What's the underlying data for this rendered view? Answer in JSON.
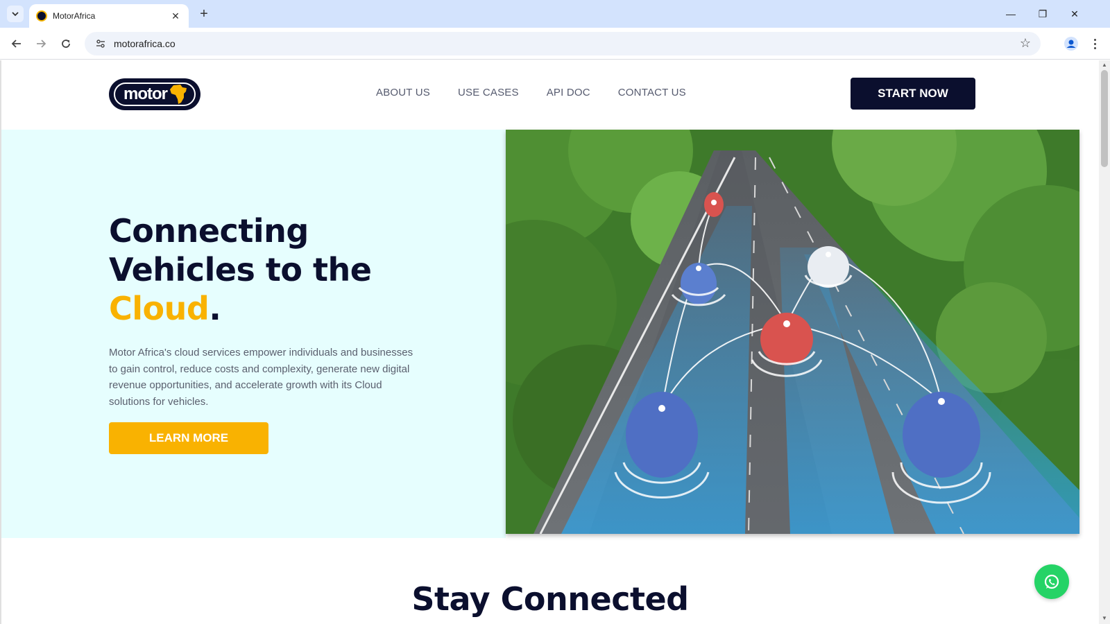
{
  "browser": {
    "tab_title": "MotorAfrica",
    "url": "motorafrica.co",
    "new_tab": "+",
    "close_tab": "✕",
    "win_minimize": "—",
    "win_restore": "❐",
    "win_close": "✕"
  },
  "header": {
    "logo_text": "motor",
    "nav": [
      "ABOUT US",
      "USE CASES",
      "API DOC",
      "CONTACT US"
    ],
    "cta": "START NOW"
  },
  "hero": {
    "title_line1": "Connecting",
    "title_line2": "Vehicles to the",
    "title_accent": "Cloud",
    "title_end": ".",
    "description": "Motor Africa's cloud services empower individuals and businesses to gain control, reduce costs and complexity, generate new digital revenue opportunities, and accelerate growth with its Cloud solutions for vehicles.",
    "button": "LEARN MORE"
  },
  "section": {
    "title": "Stay Connected"
  },
  "colors": {
    "brand_navy": "#0b0f2e",
    "accent_yellow": "#f9b201",
    "hero_bg": "#e6fefe",
    "whatsapp_green": "#25d366"
  },
  "icons": [
    "tab-search-icon",
    "favicon-icon",
    "back-arrow-icon",
    "forward-arrow-icon",
    "reload-icon",
    "site-info-icon",
    "bookmark-star-icon",
    "profile-icon",
    "menu-icon",
    "whatsapp-icon"
  ]
}
